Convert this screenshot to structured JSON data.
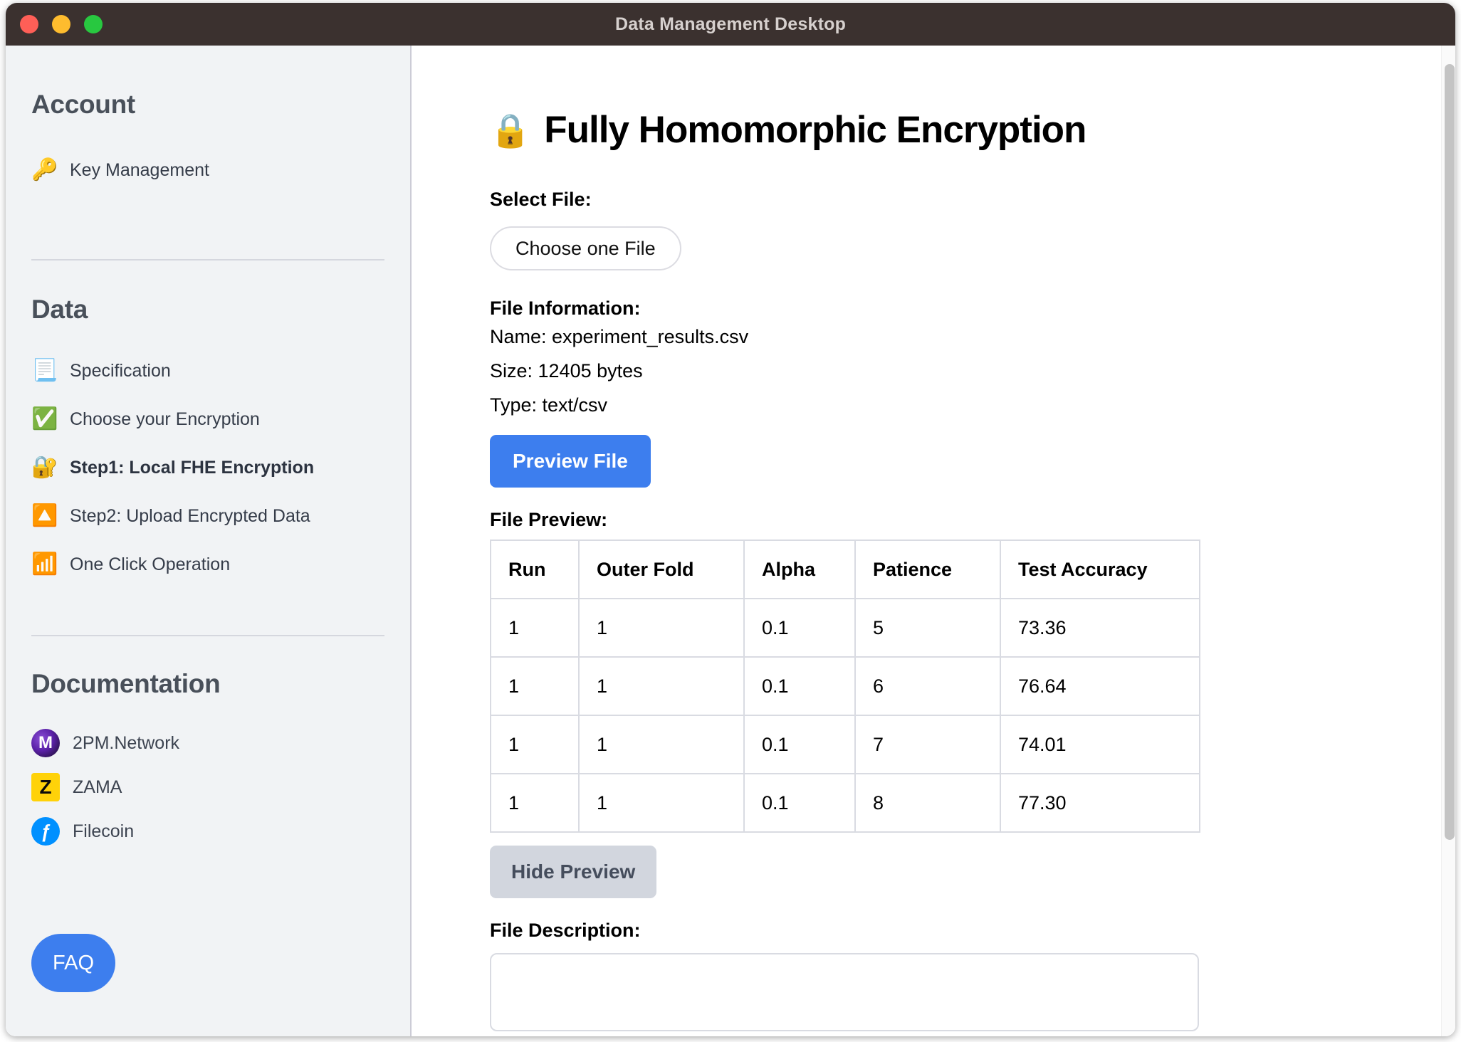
{
  "window": {
    "title": "Data Management Desktop",
    "traffic_lights": [
      "close-red",
      "minimize-yellow",
      "maximize-green"
    ]
  },
  "sidebar": {
    "sections": [
      {
        "id": "account",
        "title": "Account",
        "items": [
          {
            "icon": "key-icon",
            "glyph": "🔑",
            "label": "Key Management",
            "active": false
          }
        ]
      },
      {
        "id": "data",
        "title": "Data",
        "items": [
          {
            "icon": "document-icon",
            "glyph": "📃",
            "label": "Specification",
            "active": false
          },
          {
            "icon": "check-mark-icon",
            "glyph": "✅",
            "label": "Choose your Encryption",
            "active": false
          },
          {
            "icon": "locked-with-key-icon",
            "glyph": "🔐",
            "label": "Step1: Local FHE Encryption",
            "active": true
          },
          {
            "icon": "upload-icon",
            "glyph": "🔼",
            "label": "Step2: Upload Encrypted Data",
            "active": false
          },
          {
            "icon": "wifi-icon",
            "glyph": "📶",
            "label": "One Click Operation",
            "active": false
          }
        ]
      }
    ],
    "documentation": {
      "title": "Documentation",
      "links": [
        {
          "icon": "2pm-network-logo-icon",
          "glyph": "M",
          "label": "2PM.Network"
        },
        {
          "icon": "zama-logo-icon",
          "glyph": "Z",
          "label": "ZAMA"
        },
        {
          "icon": "filecoin-logo-icon",
          "glyph": "ƒ",
          "label": "Filecoin"
        }
      ]
    },
    "faq_label": "FAQ"
  },
  "main": {
    "title": "Fully Homomorphic Encryption",
    "title_icon": "closed-lock-icon",
    "title_glyph": "🔒",
    "select_file_label": "Select File:",
    "choose_file_button": "Choose one File",
    "file_information_label": "File Information:",
    "file_info": {
      "name_line": "Name: experiment_results.csv",
      "size_line": "Size: 12405 bytes",
      "type_line": "Type: text/csv"
    },
    "preview_file_button": "Preview File",
    "file_preview_label": "File Preview:",
    "hide_preview_button": "Hide Preview",
    "file_description_label": "File Description:",
    "description_value": "",
    "description_placeholder": ""
  },
  "table": {
    "columns": [
      "Run",
      "Outer Fold",
      "Alpha",
      "Patience",
      "Test Accuracy"
    ],
    "rows": [
      [
        "1",
        "1",
        "0.1",
        "5",
        "73.36"
      ],
      [
        "1",
        "1",
        "0.1",
        "6",
        "76.64"
      ],
      [
        "1",
        "1",
        "0.1",
        "7",
        "74.01"
      ],
      [
        "1",
        "1",
        "0.1",
        "8",
        "77.30"
      ]
    ]
  },
  "colors": {
    "titlebar": "#3b312f",
    "sidebar_bg": "#f1f3f5",
    "accent_blue": "#3d7eee",
    "grey_button": "#d2d6de",
    "text_dark": "#353c49"
  }
}
